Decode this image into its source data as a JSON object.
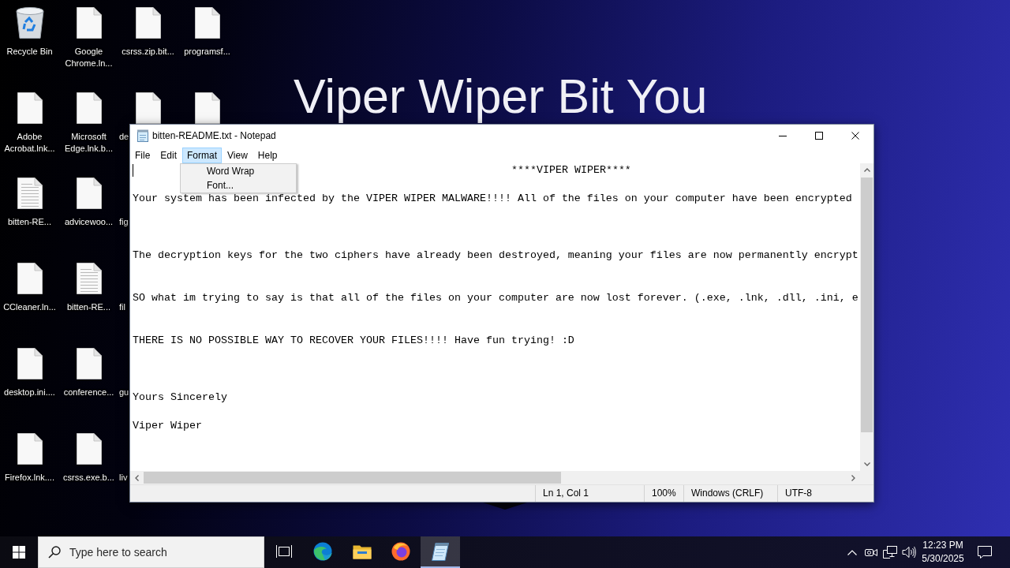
{
  "wallpaper": {
    "title": "Viper Wiper Bit You"
  },
  "desktop": {
    "rows": [
      {
        "icons": [
          {
            "kind": "recycle-bin",
            "label": "Recycle Bin"
          },
          {
            "kind": "file",
            "label": "Google Chrome.ln..."
          },
          {
            "kind": "file",
            "label": "csrss.zip.bit..."
          },
          {
            "kind": "file",
            "label": "programsf..."
          }
        ]
      },
      {
        "icons": [
          {
            "kind": "file",
            "label": "Adobe Acrobat.lnk..."
          },
          {
            "kind": "file",
            "label": "Microsoft Edge.lnk.b..."
          },
          {
            "kind": "covered-file",
            "label": "de"
          },
          {
            "kind": "covered-icon"
          }
        ]
      },
      {
        "icons": [
          {
            "kind": "text-file",
            "label": "bitten-RE..."
          },
          {
            "kind": "file",
            "label": "advicewoo..."
          },
          {
            "kind": "covered-label",
            "label": "fig"
          }
        ]
      },
      {
        "icons": [
          {
            "kind": "file",
            "label": "CCleaner.ln..."
          },
          {
            "kind": "text-file",
            "label": "bitten-RE..."
          },
          {
            "kind": "covered-label",
            "label": "fil"
          }
        ]
      },
      {
        "icons": [
          {
            "kind": "file",
            "label": "desktop.ini...."
          },
          {
            "kind": "file",
            "label": "conference..."
          },
          {
            "kind": "covered-label",
            "label": "gu"
          }
        ]
      },
      {
        "icons": [
          {
            "kind": "file",
            "label": "Firefox.lnk...."
          },
          {
            "kind": "file",
            "label": "csrss.exe.b..."
          },
          {
            "kind": "covered-label",
            "label": "liv"
          }
        ]
      }
    ]
  },
  "notepad": {
    "title": "bitten-README.txt - Notepad",
    "menu": [
      {
        "label": "File",
        "selected": false
      },
      {
        "label": "Edit",
        "selected": false
      },
      {
        "label": "Format",
        "selected": true
      },
      {
        "label": "View",
        "selected": false
      },
      {
        "label": "Help",
        "selected": false
      }
    ],
    "open_menu": {
      "items": [
        {
          "label": "Word Wrap"
        },
        {
          "label": "Font..."
        }
      ]
    },
    "text": "                                                            ****VIPER WIPER****\n\nYour system has been infected by the VIPER WIPER MALWARE!!!! All of the files on your computer have been encrypted\n\n\n\nThe decryption keys for the two ciphers have already been destroyed, meaning your files are now permanently encrypt\n\n\nSO what im trying to say is that all of the files on your computer are now lost forever. (.exe, .lnk, .dll, .ini, e\n\n\nTHERE IS NO POSSIBLE WAY TO RECOVER YOUR FILES!!!! Have fun trying! :D\n\n\n\nYours Sincerely\n\nViper Wiper",
    "status_bar": [
      "Ln 1, Col 1",
      "100%",
      "Windows (CRLF)",
      "UTF-8"
    ]
  },
  "taskbar": {
    "search": {
      "placeholder": "Type here to search"
    },
    "apps": [
      {
        "kind": "taskview",
        "active": false
      },
      {
        "kind": "swirl",
        "active": false
      },
      {
        "kind": "folder",
        "active": false
      },
      {
        "kind": "fox",
        "active": false
      },
      {
        "kind": "notepad",
        "active": true
      }
    ],
    "clock": {
      "time": "12:23 PM",
      "date": "5/30/2025"
    }
  }
}
